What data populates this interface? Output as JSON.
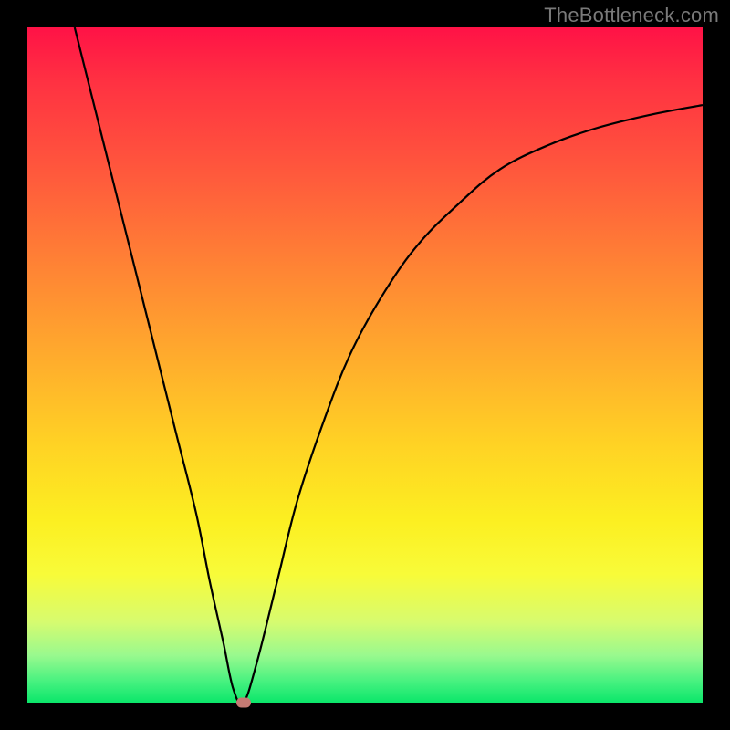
{
  "watermark": "TheBottleneck.com",
  "chart_data": {
    "type": "line",
    "title": "",
    "xlabel": "",
    "ylabel": "",
    "xlim": [
      0,
      100
    ],
    "ylim": [
      0,
      100
    ],
    "grid": false,
    "series": [
      {
        "name": "bottleneck-curve",
        "x": [
          7,
          10,
          13,
          16,
          19,
          22,
          25,
          27,
          29,
          30.5,
          32,
          34,
          37,
          40,
          44,
          48,
          53,
          58,
          64,
          70,
          77,
          84,
          92,
          100
        ],
        "y": [
          100,
          88,
          76,
          64,
          52,
          40,
          28,
          18,
          9,
          2,
          0,
          6,
          18,
          30,
          42,
          52,
          61,
          68,
          74,
          79,
          82.5,
          85,
          87,
          88.5
        ]
      }
    ],
    "marker": {
      "x": 32,
      "y": 0
    },
    "gradient_stops": [
      {
        "pos": 0,
        "color": "#ff1246"
      },
      {
        "pos": 50,
        "color": "#ffaf2c"
      },
      {
        "pos": 80,
        "color": "#f8fb39"
      },
      {
        "pos": 100,
        "color": "#0be66a"
      }
    ]
  }
}
